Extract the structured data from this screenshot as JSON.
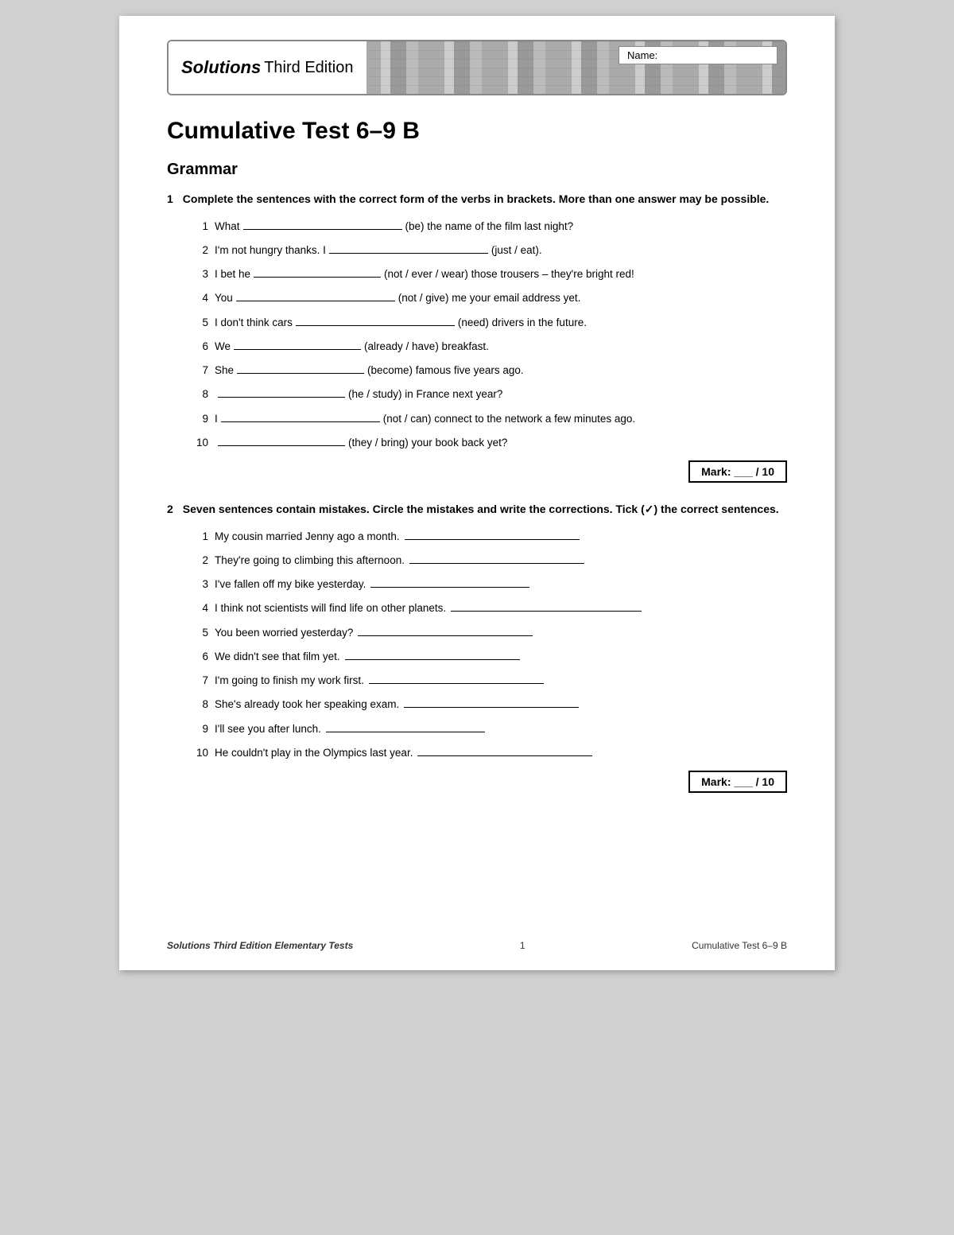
{
  "header": {
    "logo_bold": "Solutions",
    "logo_rest": " Third Edition",
    "name_label": "Name:"
  },
  "page_title": "Cumulative Test 6–9 B",
  "section1": {
    "heading": "Grammar"
  },
  "exercise1": {
    "num": "1",
    "instruction": "Complete the sentences with the correct form of the verbs in brackets. More than one answer may be possible.",
    "items": [
      {
        "num": "1",
        "before": "What",
        "hint": "(be) the name of the film last night?"
      },
      {
        "num": "2",
        "before": "I'm not hungry thanks. I",
        "hint": "(just / eat)."
      },
      {
        "num": "3",
        "before": "I bet he",
        "hint": "(not / ever / wear) those trousers – they're bright red!"
      },
      {
        "num": "4",
        "before": "You",
        "hint": "(not / give) me your email address yet."
      },
      {
        "num": "5",
        "before": "I don't think cars",
        "hint": "(need) drivers in the future."
      },
      {
        "num": "6",
        "before": "We",
        "hint": "(already / have) breakfast."
      },
      {
        "num": "7",
        "before": "She",
        "hint": "(become) famous five years ago."
      },
      {
        "num": "8",
        "before": "",
        "hint": "(he / study) in France next year?"
      },
      {
        "num": "9",
        "before": "I",
        "hint": "(not / can) connect to the network a few minutes ago."
      },
      {
        "num": "10",
        "before": "",
        "hint": "(they / bring) your book back yet?"
      }
    ],
    "mark_label": "Mark:",
    "mark_denom": "/ 10"
  },
  "exercise2": {
    "num": "2",
    "instruction": "Seven sentences contain mistakes. Circle the mistakes and write the corrections. Tick (✓) the correct sentences.",
    "items": [
      {
        "num": "1",
        "text": "My cousin married Jenny ago a month."
      },
      {
        "num": "2",
        "text": "They're going to climbing this afternoon."
      },
      {
        "num": "3",
        "text": "I've fallen off my bike yesterday."
      },
      {
        "num": "4",
        "text": "I think not scientists will find life on other planets."
      },
      {
        "num": "5",
        "text": "You been worried yesterday?"
      },
      {
        "num": "6",
        "text": "We didn't see that film yet."
      },
      {
        "num": "7",
        "text": "I'm going to finish my work first."
      },
      {
        "num": "8",
        "text": "She's already took her speaking exam."
      },
      {
        "num": "9",
        "text": "I'll see you after lunch."
      },
      {
        "num": "10",
        "text": "He couldn't play in the Olympics last year."
      }
    ],
    "mark_label": "Mark:",
    "mark_denom": "/ 10"
  },
  "footer": {
    "left_italic": "Solutions",
    "left_rest": " Third Edition Elementary Tests",
    "page_num": "1",
    "right": "Cumulative Test 6–9 B"
  }
}
